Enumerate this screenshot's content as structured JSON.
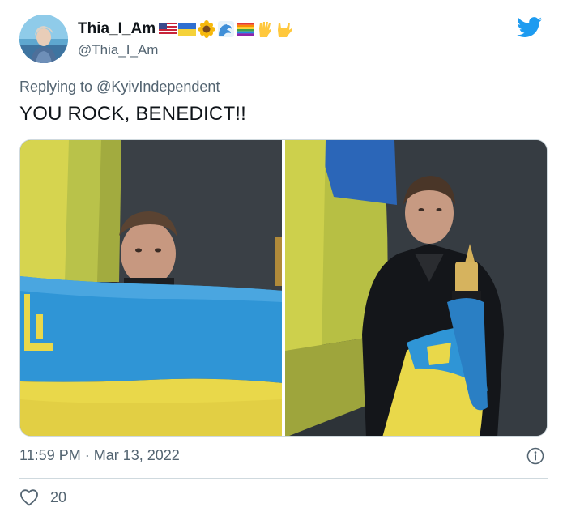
{
  "author": {
    "display_name": "Thia_I_Am",
    "handle": "@Thia_I_Am",
    "name_emojis": [
      "us-flag",
      "ukraine-flag",
      "sunflower",
      "wave",
      "rainbow-flag",
      "vulcan-salute",
      "rock-on-hand"
    ]
  },
  "reply": {
    "prefix": "Replying to ",
    "mention": "@KyivIndependent"
  },
  "tweet": {
    "text": "YOU ROCK, BENEDICT!!",
    "timestamp": "11:59 PM · Mar 13, 2022",
    "likes": "20"
  },
  "colors": {
    "twitter_blue": "#1d9bf0",
    "secondary_text": "#536471",
    "flag_blue": "#2f95d6",
    "flag_yellow": "#e9d84a"
  }
}
